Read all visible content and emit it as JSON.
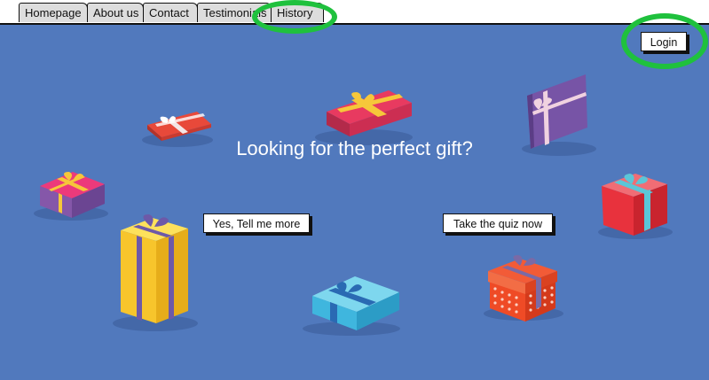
{
  "nav": {
    "tabs": [
      {
        "label": "Homepage"
      },
      {
        "label": "About us"
      },
      {
        "label": "Contact"
      },
      {
        "label": "Testimonials"
      },
      {
        "label": "History"
      }
    ]
  },
  "header": {
    "login_label": "Login"
  },
  "hero": {
    "headline": "Looking for the perfect gift?",
    "cta_primary": "Yes, Tell me more",
    "cta_secondary": "Take the quiz now"
  },
  "colors": {
    "hero_bg": "#5179bd",
    "highlight": "#1fc13d"
  }
}
